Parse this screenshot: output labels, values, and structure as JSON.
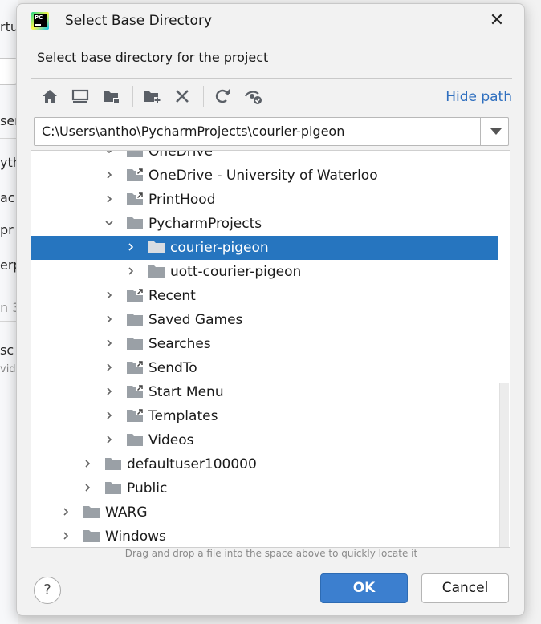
{
  "background": {
    "fragments": [
      "rtu",
      "ser",
      "yth",
      "ack",
      "pr",
      "erp",
      "n 3",
      "sc",
      "vide"
    ]
  },
  "dialog": {
    "title": "Select Base Directory",
    "close_glyph": "✕",
    "subtitle": "Select base directory for the project",
    "toolbar": {
      "icons": [
        "home-icon",
        "desktop-icon",
        "project-folder-icon",
        "new-folder-icon",
        "delete-icon",
        "refresh-icon",
        "show-hidden-icon"
      ],
      "hide_path_label": "Hide path"
    },
    "path": "C:\\Users\\antho\\PycharmProjects\\courier-pigeon",
    "tree": {
      "partial_top_label": "OneDrive",
      "rows": [
        {
          "label": "OneDrive - University of Waterloo",
          "expanded": false,
          "link": true
        },
        {
          "label": "PrintHood",
          "expanded": false,
          "link": true
        },
        {
          "label": "PycharmProjects",
          "expanded": true,
          "link": false
        },
        {
          "label": "courier-pigeon",
          "expanded": false,
          "link": false,
          "selected": true
        },
        {
          "label": "uott-courier-pigeon",
          "expanded": false,
          "link": false
        },
        {
          "label": "Recent",
          "expanded": false,
          "link": true
        },
        {
          "label": "Saved Games",
          "expanded": false,
          "link": false
        },
        {
          "label": "Searches",
          "expanded": false,
          "link": false
        },
        {
          "label": "SendTo",
          "expanded": false,
          "link": true
        },
        {
          "label": "Start Menu",
          "expanded": false,
          "link": true
        },
        {
          "label": "Templates",
          "expanded": false,
          "link": true
        },
        {
          "label": "Videos",
          "expanded": false,
          "link": false
        },
        {
          "label": "defaultuser100000",
          "expanded": false,
          "link": false
        },
        {
          "label": "Public",
          "expanded": false,
          "link": false
        },
        {
          "label": "WARG",
          "expanded": false,
          "link": false
        },
        {
          "label": "Windows",
          "expanded": false,
          "link": false
        }
      ]
    },
    "hint": "Drag and drop a file into the space above to quickly locate it",
    "help_label": "?",
    "ok_label": "OK",
    "cancel_label": "Cancel",
    "colors": {
      "selection": "#2675bf",
      "link": "#2f6fbf",
      "primary_button": "#3c7fcf",
      "folder": "#9aa0a6"
    }
  }
}
